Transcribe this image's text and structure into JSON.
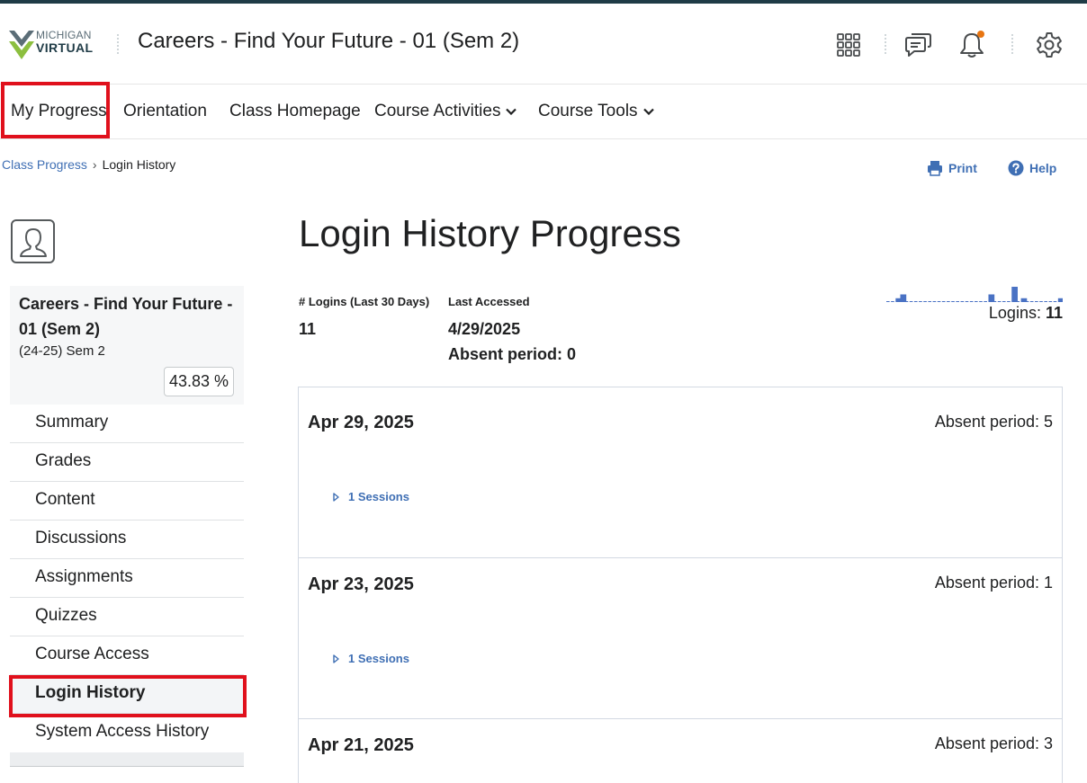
{
  "header": {
    "logo_line1": "MICHIGAN",
    "logo_line2": "VIRTUAL",
    "course_title": "Careers - Find Your Future - 01 (Sem 2)",
    "icons": [
      "apps-grid-icon",
      "chat-icon",
      "bell-icon",
      "gear-icon"
    ],
    "notification_dot_color": "#e87511"
  },
  "nav": {
    "items": [
      {
        "label": "My Progress"
      },
      {
        "label": "Orientation"
      },
      {
        "label": "Class Homepage"
      },
      {
        "label": "Course Activities",
        "dropdown": true
      },
      {
        "label": "Course Tools",
        "dropdown": true
      }
    ],
    "highlight_color": "#e0101c"
  },
  "breadcrumb": {
    "link": "Class Progress",
    "separator": "›",
    "current": "Login History"
  },
  "toolbar": {
    "print_label": "Print",
    "help_label": "Help"
  },
  "course_card": {
    "title": "Careers - Find Your Future - 01 (Sem 2)",
    "semester": "(24-25) Sem 2",
    "percent": "43.83 %"
  },
  "sidebar": {
    "items": [
      {
        "label": "Summary"
      },
      {
        "label": "Grades"
      },
      {
        "label": "Content"
      },
      {
        "label": "Discussions"
      },
      {
        "label": "Assignments"
      },
      {
        "label": "Quizzes"
      },
      {
        "label": "Course Access"
      },
      {
        "label": "Login History",
        "active": true
      },
      {
        "label": "System Access History"
      }
    ]
  },
  "main": {
    "title": "Login History Progress",
    "stats": {
      "logins_label": "# Logins (Last 30 Days)",
      "logins_value": "11",
      "last_accessed_label": "Last Accessed",
      "last_accessed_value": "4/29/2025",
      "absent_period": "Absent period: 0"
    },
    "sparkline": {
      "values": [
        0,
        0,
        1,
        2,
        0,
        0,
        0,
        0,
        0,
        0,
        0,
        0,
        0,
        0,
        0,
        0,
        0,
        0,
        0,
        0,
        0,
        0,
        2,
        0,
        0,
        0,
        0,
        4,
        0,
        1,
        0,
        0,
        0,
        0,
        0,
        0,
        0,
        1
      ],
      "color": "#4a72c4",
      "total_label": "Logins:",
      "total_value": "11"
    },
    "entries": [
      {
        "date": "Apr 29, 2025",
        "absent": "Absent period: 5",
        "sessions": "1 Sessions"
      },
      {
        "date": "Apr 23, 2025",
        "absent": "Absent period: 1",
        "sessions": "1 Sessions"
      },
      {
        "date": "Apr 21, 2025",
        "absent": "Absent period: 3",
        "sessions": ""
      }
    ]
  }
}
